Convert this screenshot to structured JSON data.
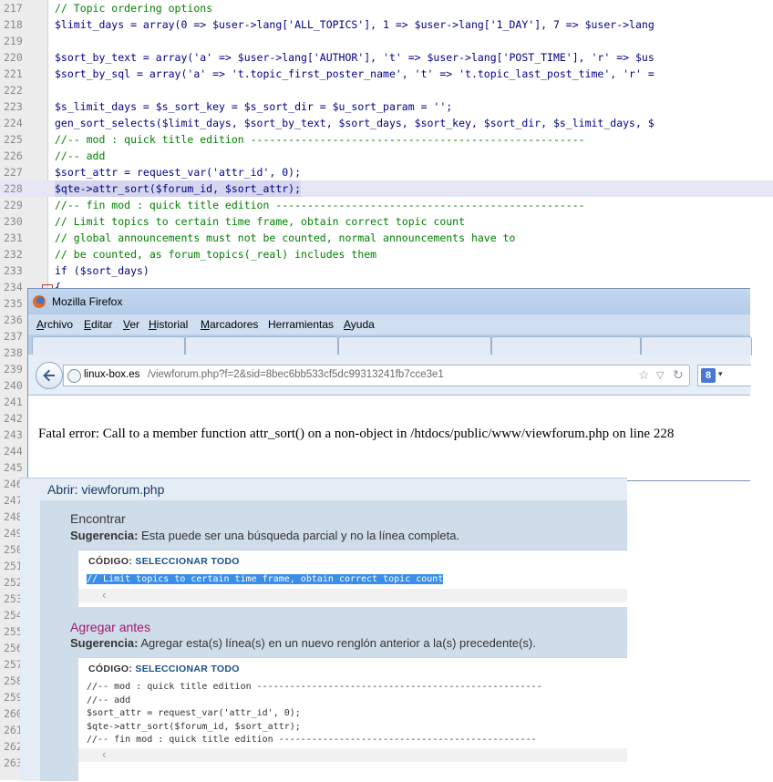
{
  "editor": {
    "lines": [
      {
        "n": "217",
        "t": "// Topic ordering options",
        "kind": "comment"
      },
      {
        "n": "218",
        "t": "$limit_days = array(0 => $user->lang['ALL_TOPICS'], 1 => $user->lang['1_DAY'], 7 => $user->lang",
        "kind": "code"
      },
      {
        "n": "219",
        "t": "",
        "kind": "code"
      },
      {
        "n": "220",
        "t": "$sort_by_text = array('a' => $user->lang['AUTHOR'], 't' => $user->lang['POST_TIME'], 'r' => $us",
        "kind": "code"
      },
      {
        "n": "221",
        "t": "$sort_by_sql = array('a' => 't.topic_first_poster_name', 't' => 't.topic_last_post_time', 'r' =",
        "kind": "code"
      },
      {
        "n": "222",
        "t": "",
        "kind": "code"
      },
      {
        "n": "223",
        "t": "$s_limit_days = $s_sort_key = $s_sort_dir = $u_sort_param = '';",
        "kind": "code"
      },
      {
        "n": "224",
        "t": "gen_sort_selects($limit_days, $sort_by_text, $sort_days, $sort_key, $sort_dir, $s_limit_days, $",
        "kind": "code"
      },
      {
        "n": "225",
        "t": "//-- mod : quick title edition -----------------------------------------------------",
        "kind": "comment"
      },
      {
        "n": "226",
        "t": "//-- add",
        "kind": "comment"
      },
      {
        "n": "227",
        "t": "$sort_attr = request_var('attr_id', 0);",
        "kind": "code"
      },
      {
        "n": "228",
        "t": "$qte->attr_sort($forum_id, $sort_attr);",
        "kind": "highlight"
      },
      {
        "n": "229",
        "t": "//-- fin mod : quick title edition -------------------------------------------------",
        "kind": "comment"
      },
      {
        "n": "230",
        "t": "// Limit topics to certain time frame, obtain correct topic count",
        "kind": "comment"
      },
      {
        "n": "231",
        "t": "// global announcements must not be counted, normal announcements have to",
        "kind": "comment"
      },
      {
        "n": "232",
        "t": "// be counted, as forum_topics(_real) includes them",
        "kind": "comment"
      },
      {
        "n": "233",
        "t": "if ($sort_days)",
        "kind": "code"
      },
      {
        "n": "234",
        "t": "{",
        "kind": "code"
      },
      {
        "n": "235",
        "t": "",
        "kind": "code"
      },
      {
        "n": "236",
        "t": "",
        "kind": "code"
      },
      {
        "n": "237",
        "t": "",
        "kind": "code"
      },
      {
        "n": "238",
        "t": "",
        "kind": "code"
      },
      {
        "n": "239",
        "t": "",
        "kind": "code"
      },
      {
        "n": "240",
        "t": "",
        "kind": "code"
      },
      {
        "n": "241",
        "t": "",
        "kind": "code"
      },
      {
        "n": "242",
        "t": "",
        "kind": "code"
      },
      {
        "n": "243",
        "t": "",
        "kind": "code"
      },
      {
        "n": "244",
        "t": "",
        "kind": "code"
      },
      {
        "n": "245",
        "t": "",
        "kind": "code"
      },
      {
        "n": "246",
        "t": "",
        "kind": "code"
      },
      {
        "n": "247",
        "t": "",
        "kind": "code"
      },
      {
        "n": "248",
        "t": "",
        "kind": "code"
      },
      {
        "n": "249",
        "t": "",
        "kind": "code"
      },
      {
        "n": "250",
        "t": "",
        "kind": "code"
      },
      {
        "n": "251",
        "t": "",
        "kind": "code"
      },
      {
        "n": "252",
        "t": "",
        "kind": "code"
      },
      {
        "n": "253",
        "t": "",
        "kind": "code"
      },
      {
        "n": "254",
        "t": "",
        "kind": "code"
      },
      {
        "n": "255",
        "t": "",
        "kind": "code"
      },
      {
        "n": "256",
        "t": "",
        "kind": "code"
      },
      {
        "n": "257",
        "t": "",
        "kind": "code"
      },
      {
        "n": "258",
        "t": "",
        "kind": "code"
      },
      {
        "n": "259",
        "t": "",
        "kind": "code"
      },
      {
        "n": "260",
        "t": "",
        "kind": "code"
      },
      {
        "n": "261",
        "t": "",
        "kind": "code"
      },
      {
        "n": "262",
        "t": "",
        "kind": "code"
      },
      {
        "n": "263",
        "t": "",
        "kind": "code"
      }
    ]
  },
  "firefox": {
    "title": "Mozilla Firefox",
    "menu": [
      {
        "u": "A",
        "rest": "rchivo"
      },
      {
        "u": "E",
        "rest": "ditar"
      },
      {
        "u": "V",
        "rest": "er"
      },
      {
        "u": "H",
        "rest": "istorial"
      },
      {
        "u": "M",
        "rest": "arcadores"
      },
      {
        "u": "",
        "rest": "Herramientas"
      },
      {
        "u": "A",
        "rest": "yuda"
      }
    ],
    "url_host": "linux-box.es",
    "url_path": "/viewforum.php?f=2&sid=8bec6bb533cf5dc99313241fb7cce3e1",
    "star_icon": "☆",
    "dropdown_icon": "▽",
    "reload_icon": "↻",
    "search_engine_letter": "8",
    "search_dropdown": "▾",
    "error_text": "Fatal error: Call to a member function attr_sort() on a non-object in /htdocs/public/www/viewforum.php on line 228"
  },
  "mod": {
    "title": "Abrir: viewforum.php",
    "find": {
      "heading": "Encontrar",
      "suggestion_label": "Sugerencia:",
      "suggestion_text": " Esta puede ser una búsqueda parcial y no la línea completa.",
      "code_label": "CÓDIGO:",
      "select_all": "SELECCIONAR TODO",
      "code": "// Limit topics to certain time frame, obtain correct topic count"
    },
    "add_before": {
      "heading": "Agregar antes",
      "suggestion_label": "Sugerencia:",
      "suggestion_text": " Agregar esta(s) línea(s) en un nuevo renglón anterior a la(s) precedente(s).",
      "code_label": "CÓDIGO:",
      "select_all": "SELECCIONAR TODO",
      "code": "//-- mod : quick title edition ----------------------------------------------------\n//-- add\n$sort_attr = request_var('attr_id', 0);\n$qte->attr_sort($forum_id, $sort_attr);\n//-- fin mod : quick title edition -----------------------------------------------"
    },
    "scroll_left_icon": "‹"
  },
  "colors": {
    "heading_find": "#3a3a3a",
    "heading_add": "#a0186e",
    "selection": "#3b8ee8"
  }
}
